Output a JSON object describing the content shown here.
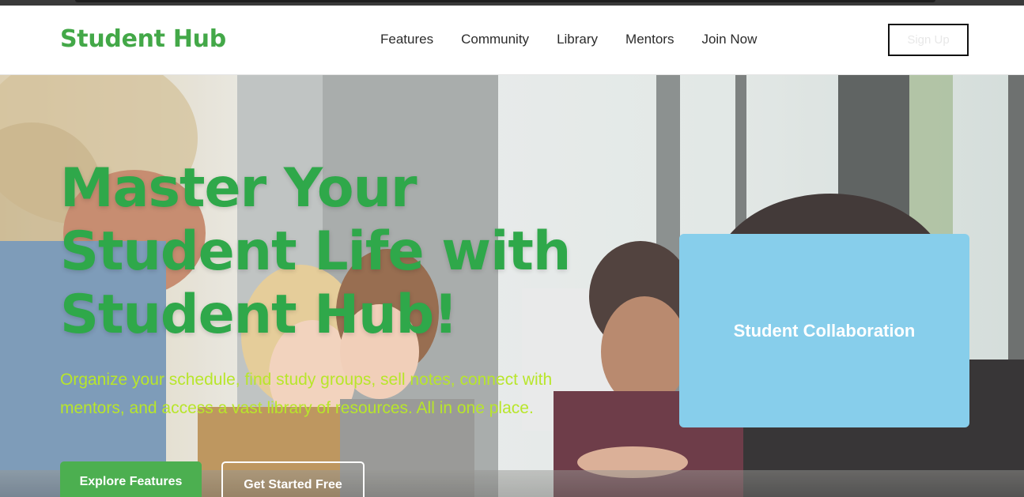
{
  "header": {
    "logo": "Student Hub",
    "nav": [
      "Features",
      "Community",
      "Library",
      "Mentors",
      "Join Now"
    ],
    "signup_label": "Sign Up"
  },
  "hero": {
    "headline_lines": [
      "Master Your",
      "Student Life with",
      "Student Hub!"
    ],
    "subtitle": "Organize your schedule, find study groups, sell notes, connect with mentors, and access a vast library of resources. All in one place.",
    "primary_button": "Explore Features",
    "secondary_button": "Get Started Free",
    "card_label": "Student Collaboration"
  },
  "colors": {
    "brand_green": "#43a848",
    "headline_green": "#2fa84a",
    "subtitle_lime": "#b8e62a",
    "card_blue": "#87ceeb"
  }
}
